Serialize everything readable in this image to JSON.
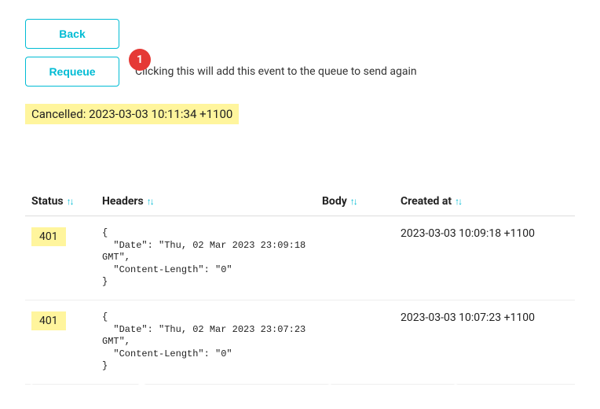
{
  "buttons": {
    "back": "Back",
    "requeue": "Requeue"
  },
  "marker": "1",
  "requeue_caption": "Clicking this will add this event to the queue to send again",
  "cancelled_text": "Cancelled: 2023-03-03 10:11:34 +1100",
  "columns": {
    "status": "Status",
    "headers": "Headers",
    "body": "Body",
    "created_at": "Created at"
  },
  "sort_glyph": "↑↓",
  "rows": [
    {
      "status": "401",
      "headers": "{\n  \"Date\": \"Thu, 02 Mar 2023 23:09:18 GMT\",\n  \"Content-Length\": \"0\"\n}",
      "body": "",
      "created_at": "2023-03-03 10:09:18 +1100"
    },
    {
      "status": "401",
      "headers": "{\n  \"Date\": \"Thu, 02 Mar 2023 23:07:23 GMT\",\n  \"Content-Length\": \"0\"\n}",
      "body": "",
      "created_at": "2023-03-03 10:07:23 +1100"
    }
  ]
}
